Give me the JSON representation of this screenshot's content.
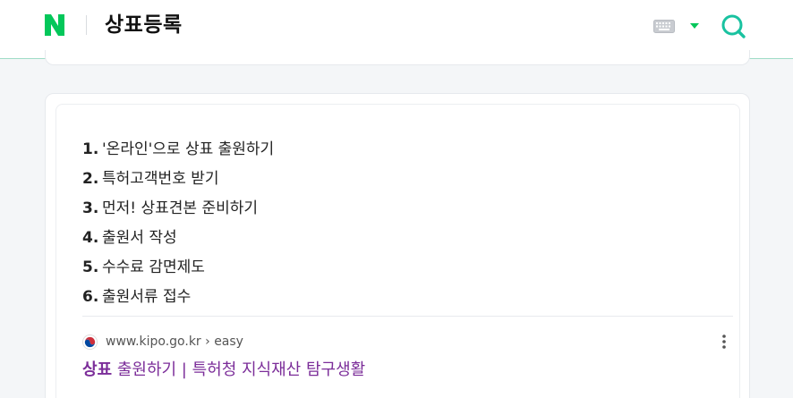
{
  "header": {
    "logo_icon": "naver-logo-icon",
    "query": "상표등록",
    "keyboard_icon": "keyboard-icon",
    "dropdown_icon": "chevron-down-icon",
    "search_icon": "search-icon",
    "accent": "#03c75a",
    "search_accent": "#19c2a0"
  },
  "result": {
    "steps": [
      {
        "num": "1.",
        "text": "'온라인'으로 상표 출원하기"
      },
      {
        "num": "2.",
        "text": "특허고객번호 받기"
      },
      {
        "num": "3.",
        "text": "먼저! 상표견본 준비하기"
      },
      {
        "num": "4.",
        "text": "출원서 작성"
      },
      {
        "num": "5.",
        "text": "수수료 감면제도"
      },
      {
        "num": "6.",
        "text": "출원서류 접수"
      }
    ],
    "source_url": "www.kipo.go.kr › easy",
    "favicon_icon": "taegeuk-icon",
    "more_icon": "more-vertical-icon",
    "link_bold": "상표",
    "link_rest": " 출원하기 | 특허청 지식재산 탐구생활",
    "link_color": "#7b2d99"
  }
}
